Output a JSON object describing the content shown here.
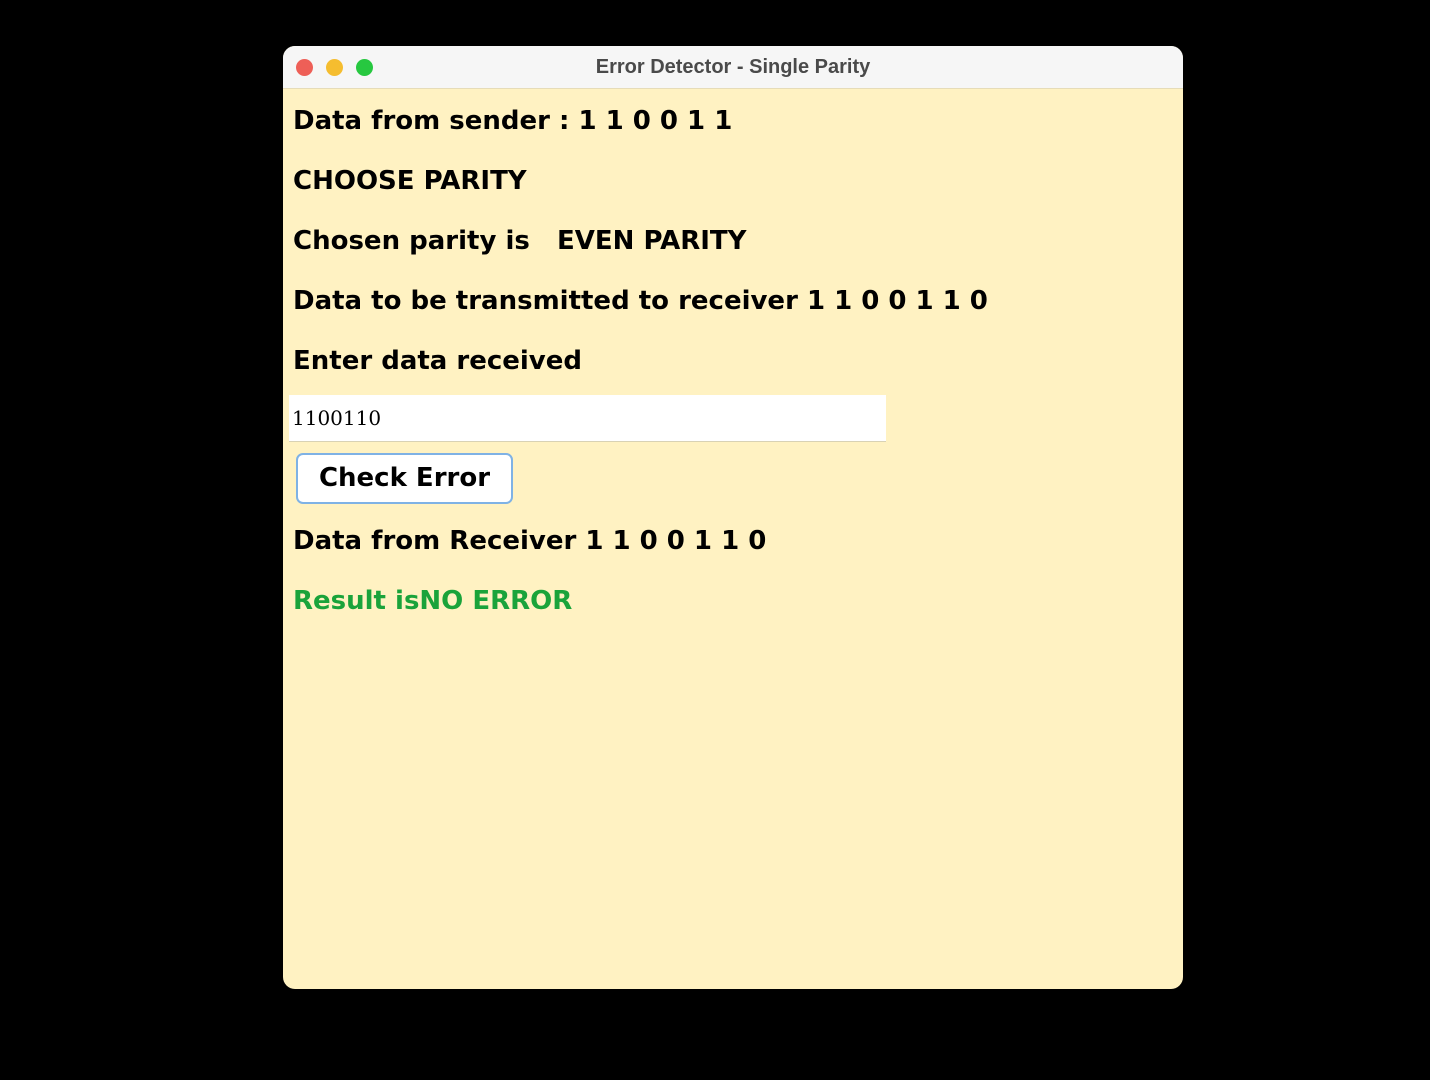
{
  "window": {
    "title": "Error Detector - Single Parity"
  },
  "sender": {
    "text": "Data from sender : 1 1 0 0 1 1"
  },
  "parity": {
    "heading": "CHOOSE PARITY",
    "chosen_text": "Chosen parity is   EVEN PARITY"
  },
  "transmit": {
    "text": "Data to be transmitted to receiver 1 1 0 0 1 1 0"
  },
  "received_input": {
    "label": "Enter data received",
    "value": "1100110"
  },
  "check_button": {
    "label": "Check Error"
  },
  "receiver": {
    "text": "Data from Receiver 1 1 0 0 1 1 0"
  },
  "result": {
    "text": "Result isNO ERROR",
    "color": "#1aa33a"
  },
  "colors": {
    "window_background": "#fff2c2",
    "screen_background": "#000000",
    "button_border": "#7fb2e5"
  },
  "icons": {
    "close": "close-icon",
    "minimize": "minimize-icon",
    "zoom": "zoom-icon"
  }
}
